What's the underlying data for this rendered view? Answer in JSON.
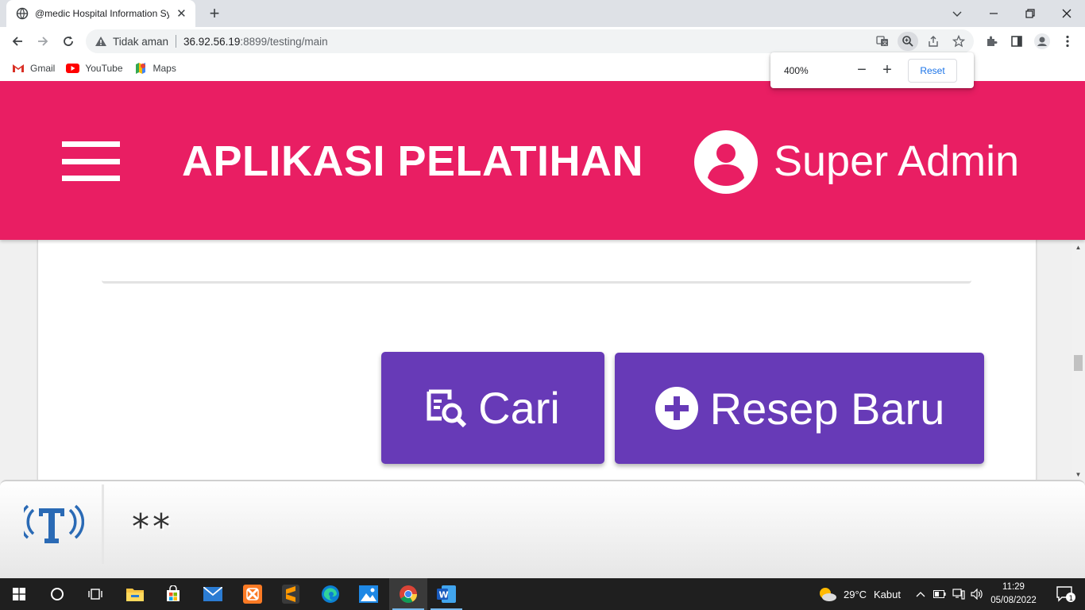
{
  "browser": {
    "tab": {
      "title": "@medic Hospital Information System",
      "close_glyph": "✕"
    },
    "new_tab_glyph": "+",
    "window_controls": {
      "minimize": "—",
      "maximize": "❐",
      "close": "✕"
    },
    "omnibox": {
      "security_label": "Tidak aman",
      "url_host": "36.92.56.19",
      "url_path": ":8899/testing/main"
    },
    "bookmarks": [
      {
        "label": "Gmail",
        "icon": "gmail-icon"
      },
      {
        "label": "YouTube",
        "icon": "youtube-icon"
      },
      {
        "label": "Maps",
        "icon": "maps-icon"
      }
    ],
    "zoom_bubble": {
      "level": "400%",
      "minus": "−",
      "plus": "+",
      "reset_label": "Reset"
    }
  },
  "app": {
    "title": "APLIKASI PELATIHAN",
    "user_name": "Super Admin",
    "buttons": {
      "search_label": "Cari",
      "new_prescription_label": "Resep Baru"
    }
  },
  "overlay": {
    "text": "**"
  },
  "taskbar": {
    "weather": {
      "temperature": "29°C",
      "condition": "Kabut"
    },
    "clock": {
      "time": "11:29",
      "date": "05/08/2022"
    },
    "notification_count": "1"
  },
  "colors": {
    "app_bar": "#e91e63",
    "primary_button": "#673ab7",
    "tab_strip": "#dee1e6",
    "taskbar": "#1f1f1f"
  }
}
